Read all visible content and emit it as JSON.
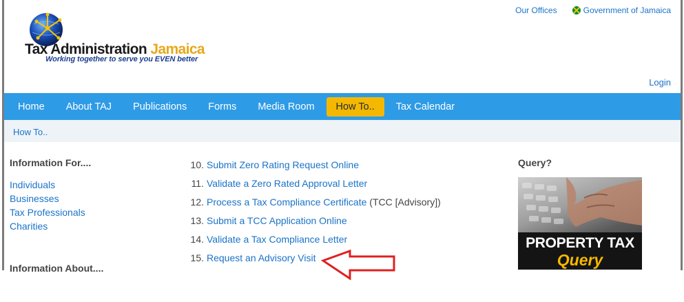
{
  "header": {
    "logo_title_main": "Tax Administration",
    "logo_title_accent": "Jamaica",
    "logo_tagline": "Working together to serve you EVEN better",
    "top_links": {
      "offices": "Our Offices",
      "government": "Government of Jamaica"
    },
    "login": "Login"
  },
  "nav": {
    "items": [
      {
        "label": "Home"
      },
      {
        "label": "About TAJ"
      },
      {
        "label": "Publications"
      },
      {
        "label": "Forms"
      },
      {
        "label": "Media Room"
      },
      {
        "label": "How To.."
      },
      {
        "label": "Tax Calendar"
      }
    ],
    "active": "How To.."
  },
  "breadcrumb": "How To..",
  "left": {
    "info_for_title": "Information For....",
    "info_for_links": [
      "Individuals",
      "Businesses",
      "Tax Professionals",
      "Charities"
    ],
    "info_about_title": "Information About...."
  },
  "main": {
    "items": [
      {
        "num": "10.",
        "link": "Submit Zero Rating Request Online",
        "suffix": ""
      },
      {
        "num": "11.",
        "link": "Validate a Zero Rated Approval Letter",
        "suffix": ""
      },
      {
        "num": "12.",
        "link": "Process a Tax Compliance Certificate",
        "suffix": " (TCC [Advisory])"
      },
      {
        "num": "13.",
        "link": "Submit a TCC Application Online",
        "suffix": ""
      },
      {
        "num": "14.",
        "link": "Validate a Tax Compliance Letter",
        "suffix": ""
      },
      {
        "num": "15.",
        "link": "Request an Advisory Visit",
        "suffix": ""
      }
    ]
  },
  "right": {
    "query_title": "Query?",
    "promo_line1": "PROPERTY TAX",
    "promo_line2": "Query"
  },
  "colors": {
    "nav_bg": "#2e9be6",
    "nav_active": "#f5b800",
    "link": "#1a73c8",
    "annotation_arrow": "#e02020"
  }
}
